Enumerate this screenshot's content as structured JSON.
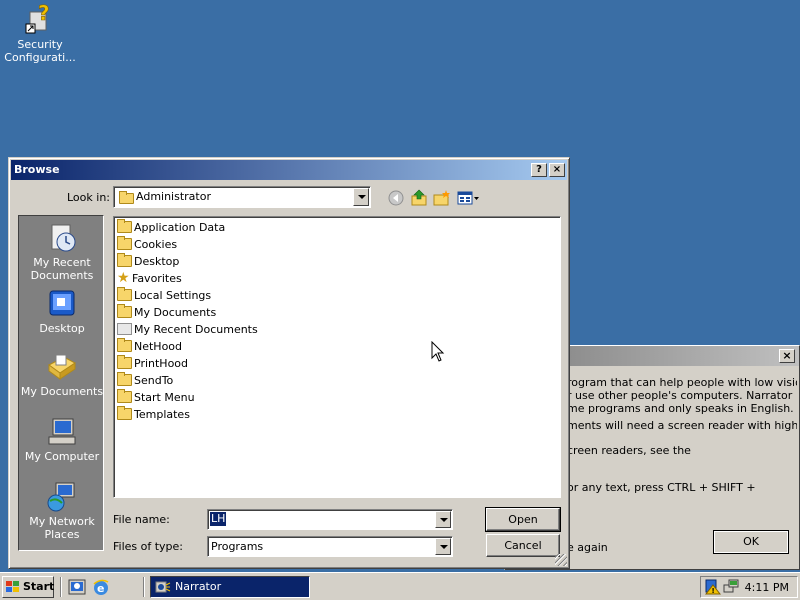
{
  "desktop": {
    "icon_label": "Security Configurati..."
  },
  "browse": {
    "title": "Browse",
    "help_label": "?",
    "close_label": "×",
    "look_in_label": "Look in:",
    "look_in_value": "Administrator",
    "places": [
      {
        "label": "My Recent Documents",
        "icon": "recent-docs-icon"
      },
      {
        "label": "Desktop",
        "icon": "desktop-icon"
      },
      {
        "label": "My Documents",
        "icon": "my-documents-icon"
      },
      {
        "label": "My Computer",
        "icon": "my-computer-icon"
      },
      {
        "label": "My Network Places",
        "icon": "network-places-icon"
      }
    ],
    "files": [
      {
        "name": "Application Data",
        "icon": "folder"
      },
      {
        "name": "Cookies",
        "icon": "folder"
      },
      {
        "name": "Desktop",
        "icon": "folder"
      },
      {
        "name": "Favorites",
        "icon": "star"
      },
      {
        "name": "Local Settings",
        "icon": "folder"
      },
      {
        "name": "My Documents",
        "icon": "folder"
      },
      {
        "name": "My Recent Documents",
        "icon": "recent"
      },
      {
        "name": "NetHood",
        "icon": "folder"
      },
      {
        "name": "PrintHood",
        "icon": "folder"
      },
      {
        "name": "SendTo",
        "icon": "folder"
      },
      {
        "name": "Start Menu",
        "icon": "folder"
      },
      {
        "name": "Templates",
        "icon": "folder"
      }
    ],
    "file_name_label": "File name:",
    "file_name_value": "LH",
    "files_of_type_label": "Files of type:",
    "files_of_type_value": "Programs",
    "open_label": "Open",
    "cancel_label": "Cancel"
  },
  "narrator": {
    "close_label": "×",
    "lines": [
      "rogram that can help people with low vision",
      "r use other people's computers. Narrator",
      "me programs and only speaks in English.",
      "ments will need a screen reader with higher",
      "creen readers, see the",
      "or any text, press CTRL + SHIFT +"
    ],
    "again_text": "e again",
    "ok_label": "OK"
  },
  "taskbar": {
    "start_label": "Start",
    "task_label": "Narrator",
    "clock": "4:11 PM"
  }
}
